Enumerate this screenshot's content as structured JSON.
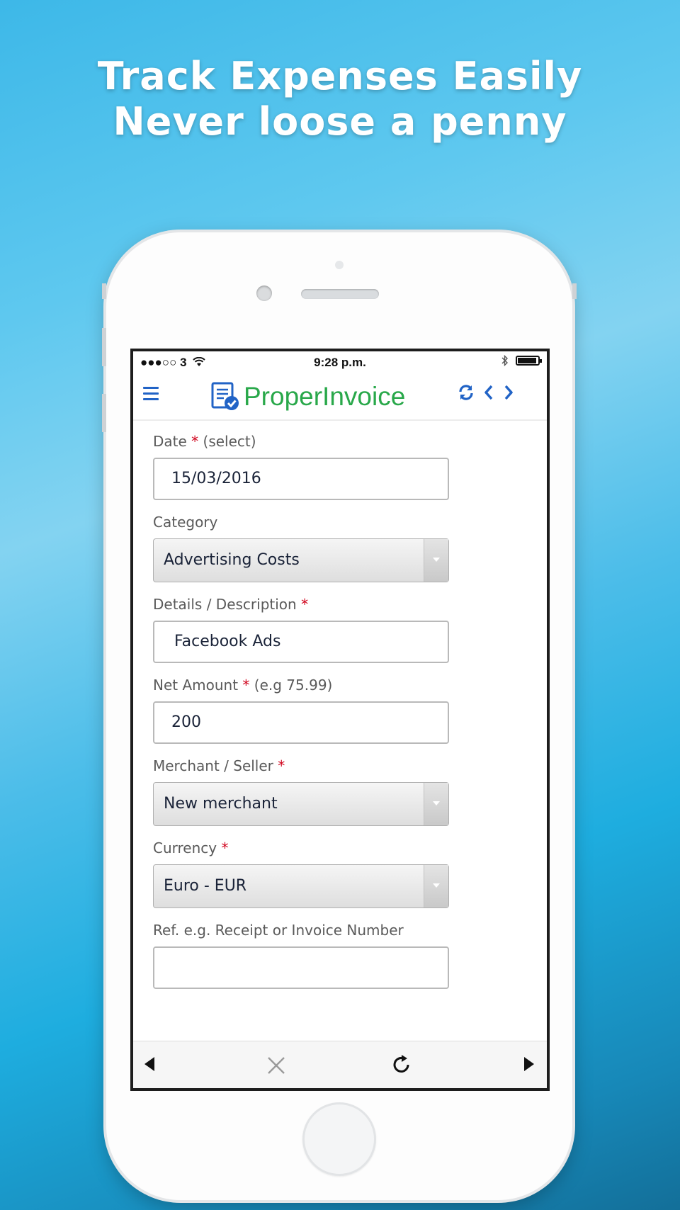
{
  "promo": {
    "line1": "Track Expenses Easily",
    "line2": "Never loose a penny"
  },
  "status_bar": {
    "carrier": "●●●○○ 3",
    "time": "9:28 p.m."
  },
  "app": {
    "name": "ProperInvoice",
    "accent_color": "#29a84a",
    "icon_color": "#2163c6"
  },
  "form": {
    "date": {
      "label": "Date",
      "required_mark": "*",
      "hint": "(select)",
      "value": "15/03/2016"
    },
    "category": {
      "label": "Category",
      "selected": "Advertising Costs"
    },
    "details": {
      "label": "Details / Description",
      "required_mark": "*",
      "value": "Facebook Ads"
    },
    "net_amount": {
      "label": "Net Amount",
      "required_mark": "*",
      "hint": "(e.g 75.99)",
      "value": "200"
    },
    "merchant": {
      "label": "Merchant / Seller",
      "required_mark": "*",
      "selected": "New merchant"
    },
    "currency": {
      "label": "Currency",
      "required_mark": "*",
      "selected": "Euro - EUR"
    },
    "reference": {
      "label": "Ref. e.g. Receipt or Invoice Number",
      "value": ""
    }
  },
  "icons": {
    "menu": "hamburger-menu-icon",
    "sync": "sync-icon",
    "prev": "chevron-left-icon",
    "next": "chevron-right-icon",
    "back": "back-triangle-icon",
    "close": "close-icon",
    "reload": "reload-icon",
    "forward": "forward-triangle-icon"
  }
}
